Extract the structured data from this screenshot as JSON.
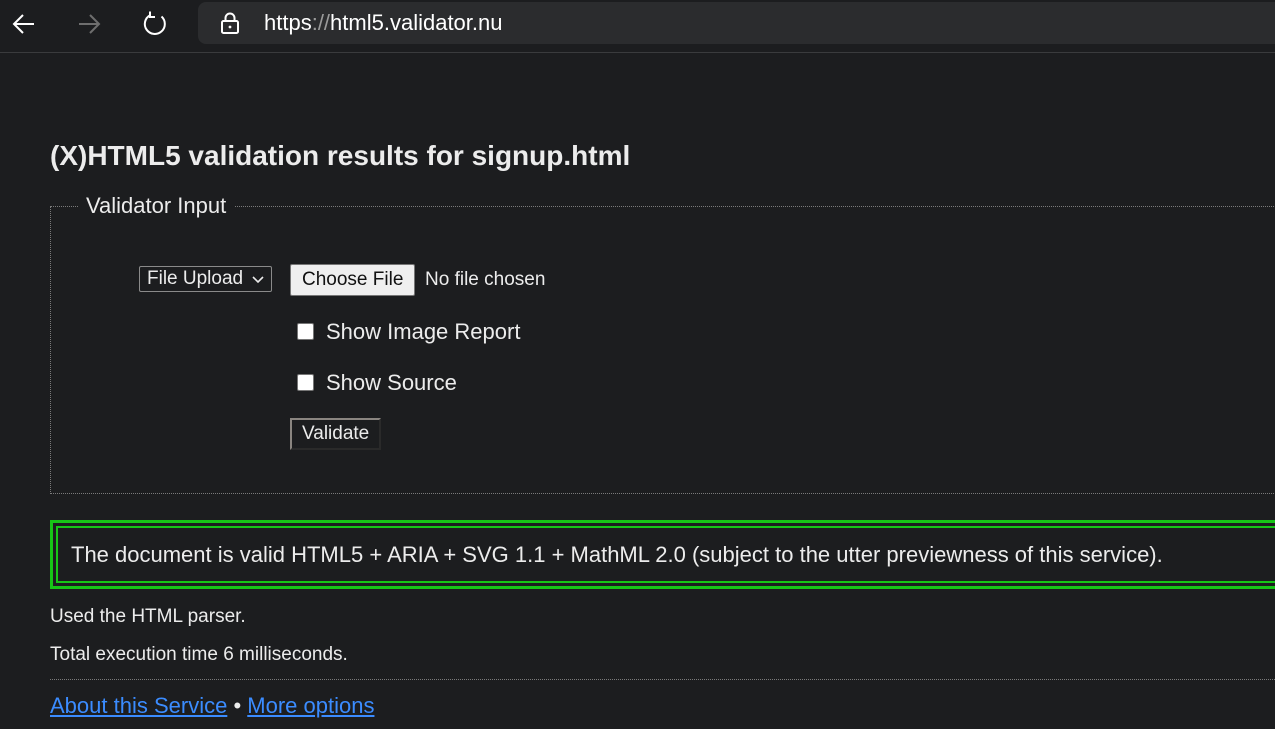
{
  "browser": {
    "url_scheme": "https",
    "url_separator": "://",
    "url_host": "html5.validator.nu",
    "back_icon": "back-arrow-icon",
    "forward_icon": "forward-arrow-icon",
    "refresh_icon": "refresh-icon",
    "lock_icon": "lock-icon"
  },
  "page": {
    "title": "(X)HTML5 validation results for signup.html",
    "form": {
      "legend": "Validator Input",
      "input_mode": "File Upload",
      "choose_file_label": "Choose File",
      "file_status": "No file chosen",
      "show_image_report_label": "Show Image Report",
      "show_image_report_checked": false,
      "show_source_label": "Show Source",
      "show_source_checked": false,
      "validate_label": "Validate"
    },
    "result": {
      "message": "The document is valid HTML5 + ARIA + SVG 1.1 + MathML 2.0 (subject to the utter previewness of this service).",
      "border_color": "#17c417"
    },
    "parser_info": "Used the HTML parser.",
    "execution_info": "Total execution time 6 milliseconds.",
    "footer": {
      "about_link": "About this Service",
      "separator": "•",
      "options_link": "More options",
      "link_color": "#3b8cff"
    }
  }
}
